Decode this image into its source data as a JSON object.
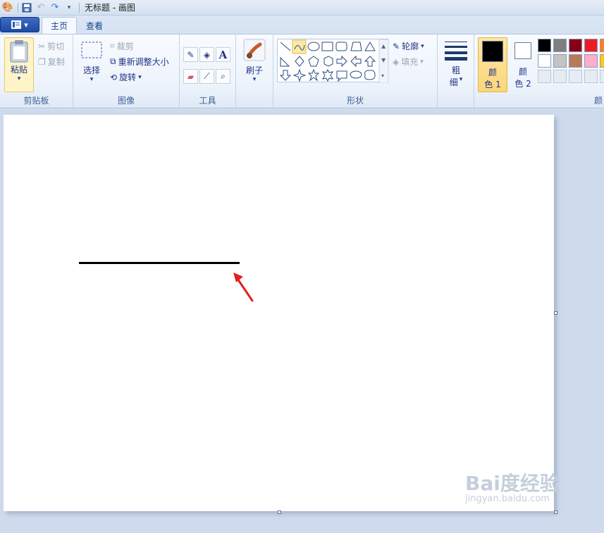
{
  "window": {
    "title": "无标题 - 画图"
  },
  "tabs": {
    "home": "主页",
    "view": "查看"
  },
  "clipboard": {
    "paste": "粘贴",
    "cut": "剪切",
    "copy": "复制",
    "group": "剪贴板"
  },
  "image": {
    "select": "选择",
    "crop": "裁剪",
    "resize": "重新调整大小",
    "rotate": "旋转",
    "group": "图像"
  },
  "tools": {
    "group": "工具",
    "text_glyph": "A"
  },
  "brushes": {
    "label": "刷子"
  },
  "shapes": {
    "outline": "轮廓",
    "fill": "填充",
    "group": "形状"
  },
  "size": {
    "label_line1": "粗",
    "label_line2": "细"
  },
  "color1": {
    "line1": "颜",
    "line2": "色 1",
    "value": "#000000"
  },
  "color2": {
    "line1": "颜",
    "line2": "色 2",
    "value": "#ffffff"
  },
  "colors_group_partial": "颜",
  "palette": {
    "row1": [
      "#000000",
      "#7f7f7f",
      "#880015",
      "#ed1c24",
      "#ff7f27"
    ],
    "row2": [
      "#ffffff",
      "#c3c3c3",
      "#b97a57",
      "#ffaec9",
      "#ffc90e"
    ],
    "row3": [
      "#e6ecf4",
      "#e6ecf4",
      "#e6ecf4",
      "#e6ecf4",
      "#e6ecf4"
    ]
  },
  "watermark": {
    "brand": "Bai度经验",
    "url": "jingyan.baidu.com"
  }
}
